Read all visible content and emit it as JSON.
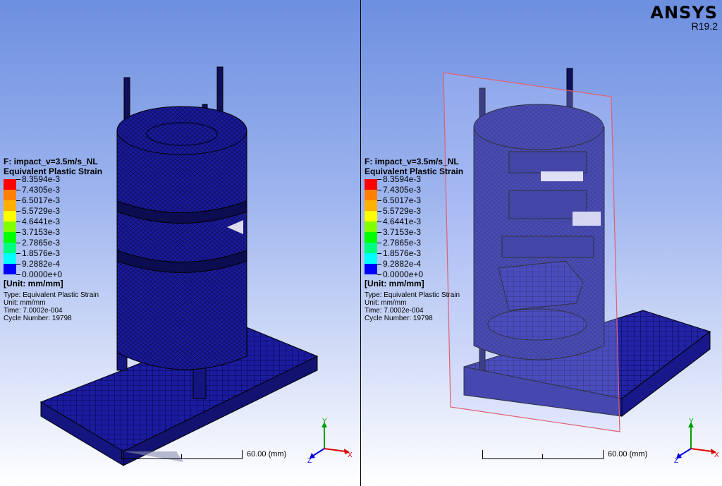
{
  "app": {
    "name": "ANSYS",
    "version": "R19.2"
  },
  "colors": {
    "legend": [
      "#ff0000",
      "#ff8000",
      "#ffb000",
      "#ffff00",
      "#80ff00",
      "#00ff00",
      "#00ff80",
      "#00ffff",
      "#0080ff",
      "#0000ff"
    ],
    "mesh_blue": "#1a1a9e",
    "section_plane": "#e06070"
  },
  "viewports": [
    {
      "id": "left",
      "view": "full-model",
      "result": {
        "title": "F: impact_v=3.5m/s_NL",
        "subtitle": "Equivalent Plastic Strain",
        "contour_labels": [
          "8.3594e-3",
          "7.4305e-3",
          "6.5017e-3",
          "5.5729e-3",
          "4.6441e-3",
          "3.7153e-3",
          "2.7865e-3",
          "1.8576e-3",
          "9.2882e-4",
          "0.0000e+0"
        ],
        "unit_label": "[Unit: mm/mm]",
        "type": "Type: Equivalent Plastic Strain",
        "unit": "Unit: mm/mm",
        "time": "Time: 7.0002e-004",
        "cycle": "Cycle Number: 19798"
      },
      "scale_label": "60.00  (mm)",
      "triad": {
        "x": "X",
        "y": "Y",
        "z": "Z"
      }
    },
    {
      "id": "right",
      "view": "section-cut",
      "result": {
        "title": "F: impact_v=3.5m/s_NL",
        "subtitle": "Equivalent Plastic Strain",
        "contour_labels": [
          "8.3594e-3",
          "7.4305e-3",
          "6.5017e-3",
          "5.5729e-3",
          "4.6441e-3",
          "3.7153e-3",
          "2.7865e-3",
          "1.8576e-3",
          "9.2882e-4",
          "0.0000e+0"
        ],
        "unit_label": "[Unit: mm/mm]",
        "type": "Type: Equivalent Plastic Strain",
        "unit": "Unit: mm/mm",
        "time": "Time: 7.0002e-004",
        "cycle": "Cycle Number: 19798"
      },
      "scale_label": "60.00  (mm)",
      "triad": {
        "x": "X",
        "y": "Y",
        "z": "Z"
      }
    }
  ]
}
